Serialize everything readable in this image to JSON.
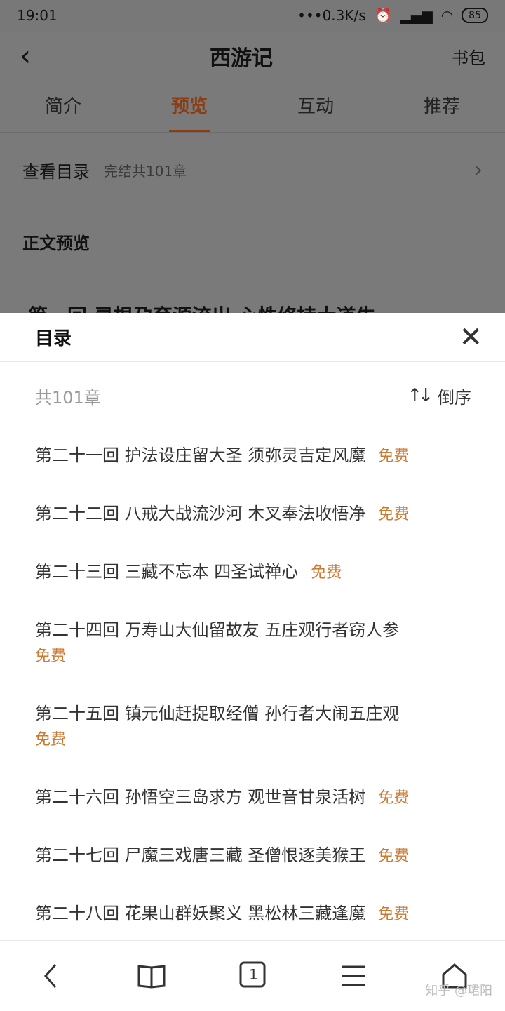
{
  "status": {
    "time": "19:01",
    "network": "•••0.3K/s",
    "battery": "85"
  },
  "nav": {
    "title": "西游记",
    "right": "书包"
  },
  "tabs": [
    "简介",
    "预览",
    "互动",
    "推荐"
  ],
  "catalog": {
    "label": "查看目录",
    "sub": "完结共101章"
  },
  "preview_title": "正文预览",
  "peek_text": "第一回 灵根孕育源流出 心性修持大道生",
  "sheet": {
    "title": "目录",
    "count": "共101章",
    "sort_label": "倒序"
  },
  "chapters": [
    {
      "title": "第二十一回 护法设庄留大圣 须弥灵吉定风魔",
      "tag": "免费"
    },
    {
      "title": "第二十二回 八戒大战流沙河 木叉奉法收悟净",
      "tag": "免费"
    },
    {
      "title": "第二十三回 三藏不忘本 四圣试禅心",
      "tag": "免费"
    },
    {
      "title": "第二十四回 万寿山大仙留故友 五庄观行者窃人参",
      "tag": "免费"
    },
    {
      "title": "第二十五回 镇元仙赶捉取经僧 孙行者大闹五庄观",
      "tag": "免费"
    },
    {
      "title": "第二十六回 孙悟空三岛求方 观世音甘泉活树",
      "tag": "免费"
    },
    {
      "title": "第二十七回 尸魔三戏唐三藏 圣僧恨逐美猴王",
      "tag": "免费"
    },
    {
      "title": "第二十八回 花果山群妖聚义 黑松林三藏逢魔",
      "tag": "免费"
    }
  ],
  "bottom": {
    "tab_count": "1"
  },
  "watermark": "知乎 @珺阳",
  "colors": {
    "accent_tab": "#8a3d12",
    "free_tag": "#cc7a32",
    "overlay": "#7a7a7a"
  }
}
